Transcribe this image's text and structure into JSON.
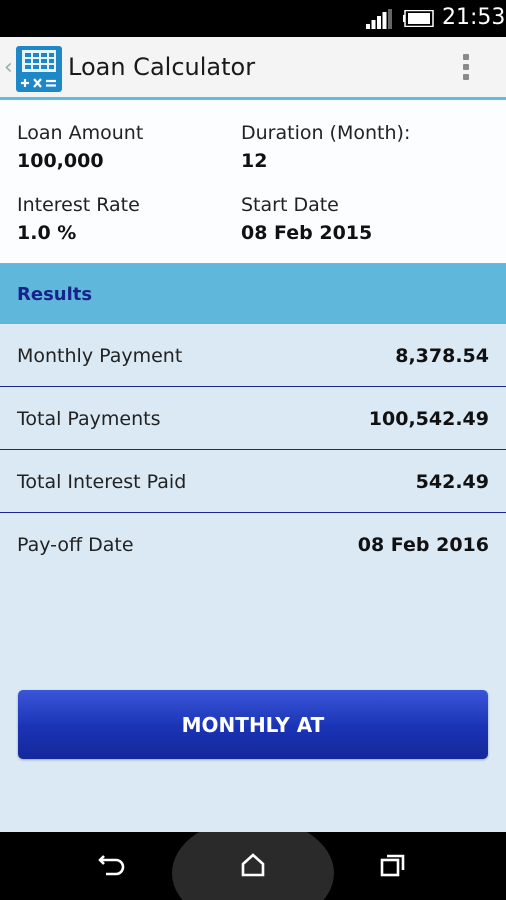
{
  "status_bar": {
    "time": "21:53"
  },
  "action_bar": {
    "title": "Loan Calculator"
  },
  "inputs": {
    "loan_amount": {
      "label": "Loan Amount",
      "value": "100,000"
    },
    "duration": {
      "label": "Duration (Month):",
      "value": "12"
    },
    "interest_rate": {
      "label": "Interest Rate",
      "value": "1.0 %"
    },
    "start_date": {
      "label": "Start Date",
      "value": "08 Feb 2015"
    }
  },
  "results": {
    "header": "Results",
    "rows": [
      {
        "label": "Monthly Payment",
        "value": "8,378.54"
      },
      {
        "label": "Total Payments",
        "value": "100,542.49"
      },
      {
        "label": "Total Interest Paid",
        "value": "542.49"
      },
      {
        "label": "Pay-off Date",
        "value": "08 Feb 2016"
      }
    ]
  },
  "button": {
    "label": "MONTHLY AT"
  },
  "colors": {
    "accent": "#5fb8dc",
    "results_text": "#17238a",
    "button": "#1a33b5",
    "background": "#dbe9f4"
  },
  "icons": [
    "signal-icon",
    "battery-icon",
    "back-chevron-icon",
    "calculator-app-icon",
    "overflow-menu-icon",
    "back-icon",
    "home-icon",
    "recents-icon"
  ]
}
